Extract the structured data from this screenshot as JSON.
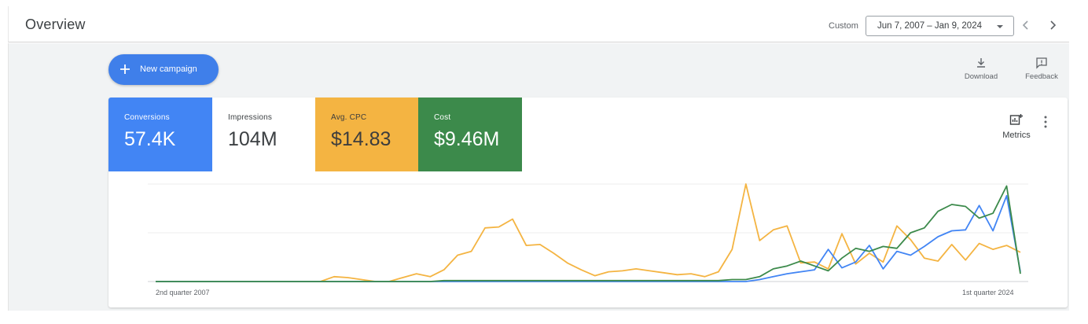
{
  "header": {
    "title": "Overview",
    "custom_label": "Custom",
    "date_range": "Jun 7, 2007 – Jan 9, 2024",
    "prev_icon": "chevron-left-icon",
    "next_icon": "chevron-right-icon"
  },
  "toolbar": {
    "new_campaign_label": "New campaign",
    "download_label": "Download",
    "feedback_label": "Feedback"
  },
  "metrics": {
    "conversions": {
      "label": "Conversions",
      "value": "57.4K",
      "color": "#4285f4"
    },
    "impressions": {
      "label": "Impressions",
      "value": "104M",
      "color": "#ffffff"
    },
    "avg_cpc": {
      "label": "Avg. CPC",
      "value": "$14.83",
      "color": "#f4b442"
    },
    "cost": {
      "label": "Cost",
      "value": "$9.46M",
      "color": "#3c8a4b"
    },
    "metrics_button_label": "Metrics"
  },
  "chart_data": {
    "type": "line",
    "x_start_label": "2nd quarter 2007",
    "x_end_label": "1st quarter 2024",
    "ylim": [
      0,
      100
    ],
    "grid": true,
    "series": [
      {
        "color": "#f4b442",
        "values": [
          0,
          0,
          0,
          0,
          0,
          0,
          0,
          0,
          0,
          0,
          0,
          0,
          0,
          5,
          4,
          2,
          0,
          0,
          4,
          8,
          5,
          12,
          27,
          31,
          55,
          56,
          64,
          37,
          38,
          29,
          19,
          12,
          6,
          10,
          11,
          13,
          11,
          9,
          7,
          8,
          5,
          10,
          33,
          100,
          42,
          53,
          57,
          19,
          20,
          13,
          49,
          18,
          29,
          20,
          57,
          43,
          24,
          21,
          38,
          22,
          39,
          33,
          37,
          30
        ]
      },
      {
        "color": "#4285f4",
        "values": [
          0,
          0,
          0,
          0,
          0,
          0,
          0,
          0,
          0,
          0,
          0,
          0,
          0,
          0,
          0,
          0,
          0,
          0,
          0,
          0,
          0,
          0,
          0,
          0,
          0,
          0,
          0,
          0,
          0,
          0,
          0,
          0,
          0,
          0,
          0,
          0,
          0,
          0,
          0,
          0,
          0,
          0,
          0,
          0,
          2,
          5,
          8,
          10,
          12,
          33,
          14,
          20,
          37,
          13,
          31,
          27,
          36,
          46,
          52,
          53,
          78,
          52,
          88,
          10
        ]
      },
      {
        "color": "#3c8a4b",
        "values": [
          0,
          0,
          0,
          0,
          0,
          0,
          0,
          0,
          0,
          0,
          0,
          0,
          0,
          0,
          0,
          0,
          0,
          0,
          0,
          0,
          0,
          1,
          1,
          1,
          1,
          1,
          1,
          1,
          1,
          1,
          1,
          1,
          1,
          1,
          1,
          1,
          1,
          1,
          1,
          1,
          1,
          1,
          2,
          2,
          5,
          13,
          16,
          21,
          16,
          11,
          24,
          34,
          31,
          36,
          34,
          50,
          55,
          72,
          79,
          77,
          65,
          70,
          98,
          8
        ]
      }
    ]
  }
}
